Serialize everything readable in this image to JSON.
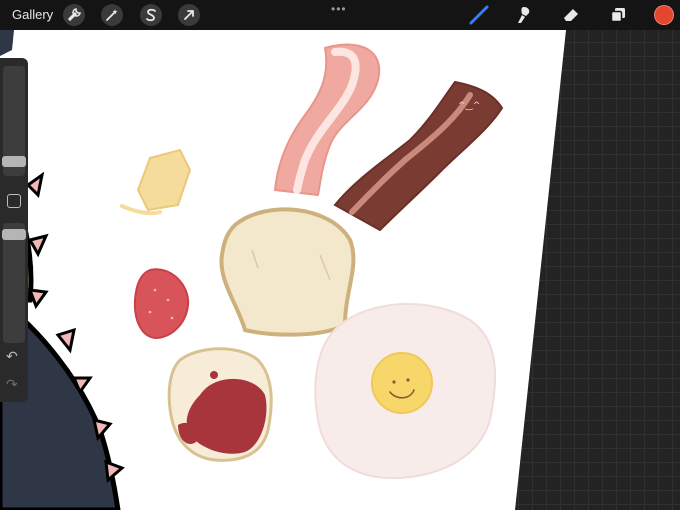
{
  "topbar": {
    "gallery_label": "Gallery",
    "left_tools": [
      {
        "icon": "wrench-icon",
        "name": "actions-button"
      },
      {
        "icon": "magic-wand-icon",
        "name": "adjustments-button"
      },
      {
        "icon": "selection-icon",
        "name": "selection-button"
      },
      {
        "icon": "arrow-icon",
        "name": "transform-button"
      }
    ],
    "center_handle": "•••",
    "right_tools": [
      {
        "icon": "brush-icon",
        "name": "brush-tool",
        "active": true
      },
      {
        "icon": "smudge-icon",
        "name": "smudge-tool"
      },
      {
        "icon": "eraser-icon",
        "name": "eraser-tool"
      },
      {
        "icon": "layers-icon",
        "name": "layers-button"
      }
    ],
    "active_color": "#e3452f",
    "accent_color": "#3a7bf7"
  },
  "sidebar": {
    "brush_size_level": 0.9,
    "opacity_level": 0.95,
    "undo_icon": "undo-icon",
    "redo_icon": "redo-icon"
  },
  "canvas": {
    "background": "#ffffff",
    "drawing_items": [
      "bacon-strip-pink",
      "bacon-strip-brown",
      "butter-cube",
      "bread-slice",
      "strawberry",
      "toast-with-jam",
      "fried-egg"
    ]
  }
}
